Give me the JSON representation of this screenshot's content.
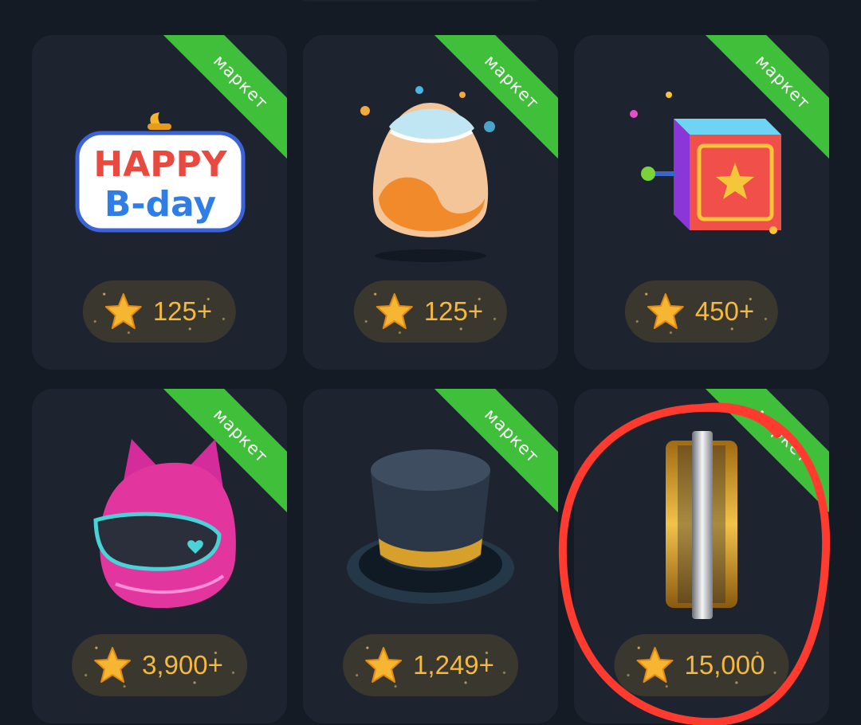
{
  "ribbon_label": "маркет",
  "colors": {
    "background": "#151b24",
    "card": "#1d2430",
    "ribbon": "#3fbf3a",
    "price_pill": "#3a372f",
    "price_text": "#f5b93b",
    "annotation": "#ff3b30"
  },
  "items": [
    {
      "icon": "happy-bday-sticker-icon",
      "price": "125+"
    },
    {
      "icon": "surprise-egg-icon",
      "price": "125+"
    },
    {
      "icon": "gift-box-icon",
      "price": "450+"
    },
    {
      "icon": "cat-helmet-icon",
      "price": "3,900+"
    },
    {
      "icon": "top-hat-icon",
      "price": "1,249+"
    },
    {
      "icon": "ring-icon",
      "price": "15,000"
    }
  ],
  "happy_bday": {
    "line1": "HAPPY",
    "line2": "B-day"
  }
}
